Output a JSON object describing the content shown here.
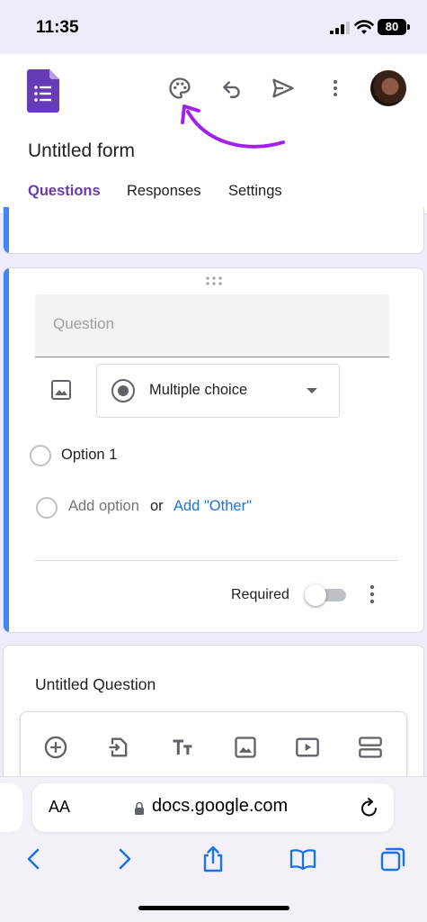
{
  "status_bar": {
    "time": "11:35",
    "battery": "80"
  },
  "header": {
    "form_title": "Untitled form",
    "tabs": [
      {
        "label": "Questions",
        "active": true
      },
      {
        "label": "Responses",
        "active": false
      },
      {
        "label": "Settings",
        "active": false
      }
    ],
    "icons": [
      "palette-icon",
      "undo-icon",
      "send-icon",
      "more-vert-icon",
      "avatar"
    ]
  },
  "question_card": {
    "question_placeholder": "Question",
    "type_label": "Multiple choice",
    "option_1": "Option 1",
    "add_option": "Add option",
    "or_text": "or",
    "add_other": "Add \"Other\"",
    "required_label": "Required",
    "required_on": false
  },
  "next_card": {
    "title": "Untitled Question"
  },
  "toolbar": {
    "icons": [
      "add-question-icon",
      "import-questions-icon",
      "add-title-icon",
      "add-image-icon",
      "add-video-icon",
      "add-section-icon"
    ]
  },
  "safari": {
    "aa_label": "AA",
    "url": "docs.google.com"
  },
  "colors": {
    "accent": "#673ab7",
    "card_accent": "#4285f4",
    "link": "#1a73e8",
    "annotation_arrow": "#a020f0"
  }
}
